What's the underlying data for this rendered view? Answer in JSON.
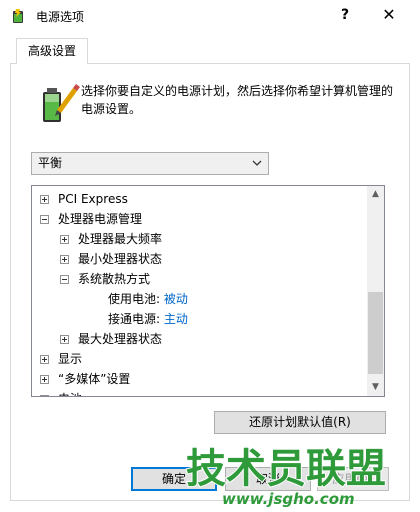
{
  "window": {
    "title": "电源选项",
    "help": "?",
    "close": "✕"
  },
  "tabs": [
    {
      "label": "高级设置"
    }
  ],
  "description": "选择你要自定义的电源计划，然后选择你希望计算机管理的电源设置。",
  "plan_dropdown": {
    "selected": "平衡"
  },
  "tree": {
    "items": [
      {
        "label": "PCI Express",
        "expander": "plus"
      },
      {
        "label": "处理器电源管理",
        "expander": "minus"
      },
      {
        "label": "处理器最大频率",
        "expander": "plus"
      },
      {
        "label": "最小处理器状态",
        "expander": "plus"
      },
      {
        "label": "系统散热方式",
        "expander": "minus"
      },
      {
        "label": "使用电池:",
        "value": "被动"
      },
      {
        "label": "接通电源:",
        "value": "主动"
      },
      {
        "label": "最大处理器状态",
        "expander": "plus"
      },
      {
        "label": "显示",
        "expander": "plus"
      },
      {
        "label": "“多媒体”设置",
        "expander": "plus"
      },
      {
        "label": "电池",
        "expander": "plus"
      }
    ]
  },
  "buttons": {
    "restore": "还原计划默认值(R)",
    "ok": "确定",
    "cancel": "取消",
    "apply": "应用(A)"
  },
  "watermark": {
    "text": "技术员联盟",
    "url": "www.jsgho.com"
  },
  "colors": {
    "link": "#0066cc",
    "focus": "#0078d7",
    "watermark": "#2e9a3a"
  }
}
